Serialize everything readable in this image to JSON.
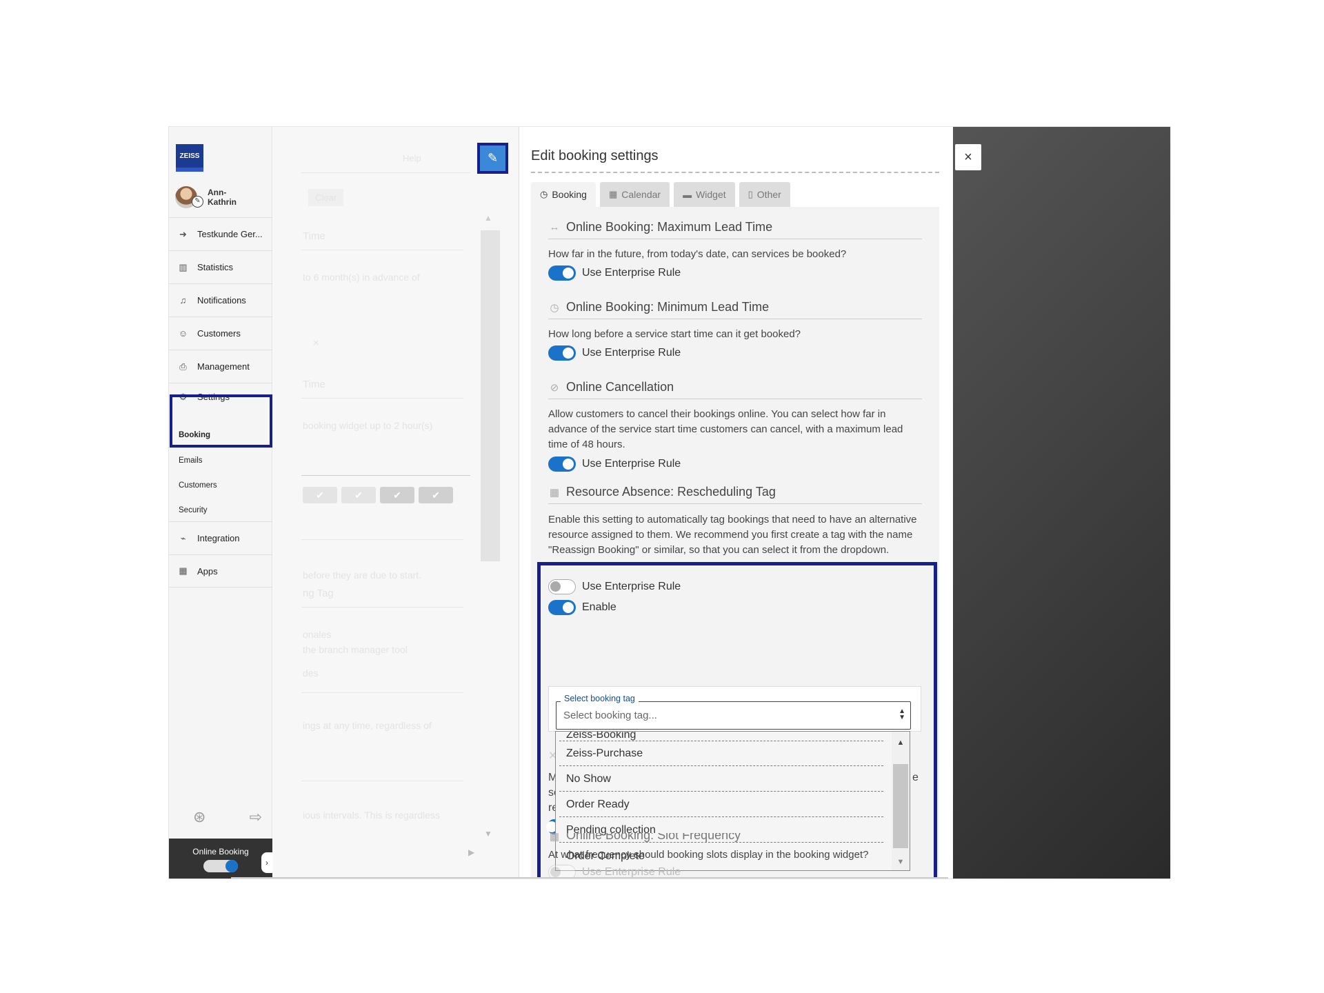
{
  "sidebar": {
    "logo_text": "ZEISS",
    "user_name": "Ann-Kathrin",
    "items": [
      {
        "label": "Testkunde Ger...",
        "icon": "circle-arrow-icon"
      },
      {
        "label": "Statistics",
        "icon": "bar-chart-icon"
      },
      {
        "label": "Notifications",
        "icon": "bell-icon"
      },
      {
        "label": "Customers",
        "icon": "user-icon"
      },
      {
        "label": "Management",
        "icon": "printer-icon"
      },
      {
        "label": "Settings",
        "icon": "gears-icon"
      }
    ],
    "settings_sub": [
      "Booking",
      "Emails",
      "Customers",
      "Security"
    ],
    "items_after": [
      {
        "label": "Integration",
        "icon": "plug-icon"
      },
      {
        "label": "Apps",
        "icon": "grid-icon"
      }
    ],
    "online_booking_label": "Online Booking"
  },
  "middle": {
    "help_label": "Help",
    "clear_label": "Clear",
    "ghost_texts": [
      "Time",
      "to 6 month(s) in advance of",
      "Time",
      "booking widget up to 2 hour(s)",
      "before they are due to start.",
      "ng Tag",
      "onales",
      "the branch manager tool",
      "des",
      "ings at any time, regardless of",
      "ious intervals. This is regardless"
    ]
  },
  "panel": {
    "title": "Edit booking settings",
    "tabs": [
      {
        "label": "Booking",
        "icon": "clock-icon",
        "active": true
      },
      {
        "label": "Calendar",
        "icon": "calendar-icon",
        "active": false
      },
      {
        "label": "Widget",
        "icon": "window-icon",
        "active": false
      },
      {
        "label": "Other",
        "icon": "document-icon",
        "active": false
      }
    ],
    "sections": {
      "max_lead": {
        "title": "Online Booking: Maximum Lead Time",
        "desc": "How far in the future, from today's date, can services be booked?",
        "toggle_label": "Use Enterprise Rule"
      },
      "min_lead": {
        "title": "Online Booking: Minimum Lead Time",
        "desc": "How long before a service start time can it get booked?",
        "toggle_label": "Use Enterprise Rule"
      },
      "cancellation": {
        "title": "Online Cancellation",
        "desc": "Allow customers to cancel their bookings online. You can select how far in advance of the service start time customers can cancel, with a maximum lead time of 48 hours.",
        "toggle_label": "Use Enterprise Rule"
      },
      "rescheduling": {
        "title": "Resource Absence: Rescheduling Tag",
        "desc": "Enable this setting to automatically tag bookings that need to have an alternative resource assigned to them. We recommend you first create a tag with the name \"Reassign Booking\" or similar, so that you can select it from the dropdown.",
        "toggle_enterprise": "Use Enterprise Rule",
        "toggle_enable": "Enable",
        "select_label": "Select booking tag",
        "select_placeholder": "Select booking tag...",
        "options": [
          "Zeiss-Booking",
          "Zeiss-Purchase",
          "No Show",
          "Order Ready",
          "Pending collection",
          "Order Complete"
        ]
      },
      "slot_frequency": {
        "title": "Online Booking: Slot Frequency",
        "desc": "At what frequency should booking slots display in the booking widget?",
        "toggle_label": "Use Enterprise Rule"
      }
    },
    "behind_letters": [
      "M",
      "se",
      "re",
      "e"
    ]
  },
  "overlay": {
    "close_label": "×"
  },
  "colors": {
    "accent": "#1a73c8",
    "highlight": "#17208a",
    "logo": "#1b3a92"
  }
}
